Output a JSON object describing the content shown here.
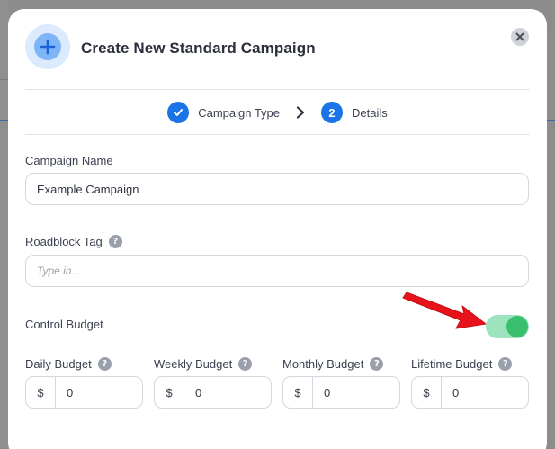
{
  "modal": {
    "title": "Create New Standard Campaign"
  },
  "stepper": {
    "steps": [
      {
        "label": "Campaign Type",
        "status": "completed"
      },
      {
        "number": "2",
        "label": "Details",
        "status": "current"
      }
    ]
  },
  "form": {
    "campaign_name": {
      "label": "Campaign Name",
      "value": "Example Campaign"
    },
    "roadblock_tag": {
      "label": "Roadblock Tag",
      "help": "?",
      "placeholder": "Type in..."
    },
    "control_budget": {
      "label": "Control Budget",
      "enabled": true
    },
    "budgets": [
      {
        "label": "Daily Budget",
        "help": "?",
        "currency": "$",
        "value": "0"
      },
      {
        "label": "Weekly Budget",
        "help": "?",
        "currency": "$",
        "value": "0"
      },
      {
        "label": "Monthly Budget",
        "help": "?",
        "currency": "$",
        "value": "0"
      },
      {
        "label": "Lifetime Budget",
        "help": "?",
        "currency": "$",
        "value": "0"
      }
    ]
  },
  "colors": {
    "accent": "#1b73e8",
    "toggle_on": "#38c06e",
    "toggle_track": "#9de3be",
    "annotation_arrow": "#e8121b"
  },
  "icons": {
    "header": "plus-icon",
    "close": "close-icon",
    "completed_step": "check-icon",
    "step_separator": "chevron-right-icon",
    "help": "question-icon"
  }
}
